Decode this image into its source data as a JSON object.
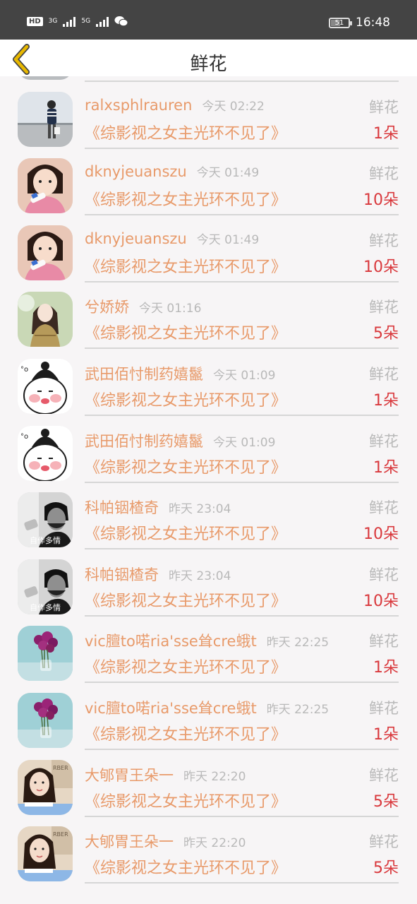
{
  "status_bar": {
    "network_badge": "HD",
    "sim1_label": "3G",
    "sim2_label": "5G",
    "battery_level": "51",
    "time": "16:48",
    "icons": [
      "hd-icon",
      "signal-icon",
      "signal-icon",
      "wechat-icon",
      "battery-icon"
    ]
  },
  "header": {
    "title": "鲜花",
    "back_icon": "chevron-left-icon",
    "accent_color": "#e8b800"
  },
  "records": [
    {
      "name": "ralxsphlrauren",
      "time": "今天 02:22",
      "type": "鲜花",
      "book": "《综影视之女主光环不见了》",
      "qty": "1朵",
      "avatar": "man-street"
    },
    {
      "name": "ralxsphlrauren",
      "time": "今天 02:22",
      "type": "鲜花",
      "book": "《综影视之女主光环不见了》",
      "qty": "1朵",
      "avatar": "man-street"
    },
    {
      "name": "dknyjeuanszu",
      "time": "今天 01:49",
      "type": "鲜花",
      "book": "《综影视之女主光环不见了》",
      "qty": "10朵",
      "avatar": "girl-pink"
    },
    {
      "name": "dknyjeuanszu",
      "time": "今天 01:49",
      "type": "鲜花",
      "book": "《综影视之女主光环不见了》",
      "qty": "10朵",
      "avatar": "girl-pink"
    },
    {
      "name": "兮娇娇",
      "time": "今天 01:16",
      "type": "鲜花",
      "book": "《综影视之女主光环不见了》",
      "qty": "5朵",
      "avatar": "anime-girl"
    },
    {
      "name": "武田佰忖制药嬉鬣",
      "time": "今天 01:09",
      "type": "鲜花",
      "book": "《综影视之女主光环不见了》",
      "qty": "1朵",
      "avatar": "cartoon-face"
    },
    {
      "name": "武田佰忖制药嬉鬣",
      "time": "今天 01:09",
      "type": "鲜花",
      "book": "《综影视之女主光环不见了》",
      "qty": "1朵",
      "avatar": "cartoon-face"
    },
    {
      "name": "科帕铟楂奇",
      "time": "昨天 23:04",
      "type": "鲜花",
      "book": "《综影视之女主光环不见了》",
      "qty": "10朵",
      "avatar": "bw-man",
      "caption": "自作多情"
    },
    {
      "name": "科帕铟楂奇",
      "time": "昨天 23:04",
      "type": "鲜花",
      "book": "《综影视之女主光环不见了》",
      "qty": "10朵",
      "avatar": "bw-man",
      "caption": "自作多情"
    },
    {
      "name": "vic膻to喏ria'sse耸cre蛾t",
      "time": "昨天 22:25",
      "type": "鲜花",
      "book": "《综影视之女主光环不见了》",
      "qty": "1朵",
      "avatar": "flower-vase"
    },
    {
      "name": "vic膻to喏ria'sse耸cre蛾t",
      "time": "昨天 22:25",
      "type": "鲜花",
      "book": "《综影视之女主光环不见了》",
      "qty": "1朵",
      "avatar": "flower-vase"
    },
    {
      "name": "大郇胃王朵一",
      "time": "昨天 22:20",
      "type": "鲜花",
      "book": "《综影视之女主光环不见了》",
      "qty": "5朵",
      "avatar": "woman-selfie"
    },
    {
      "name": "大郇胃王朵一",
      "time": "昨天 22:20",
      "type": "鲜花",
      "book": "《综影视之女主光环不见了》",
      "qty": "5朵",
      "avatar": "woman-selfie"
    }
  ]
}
